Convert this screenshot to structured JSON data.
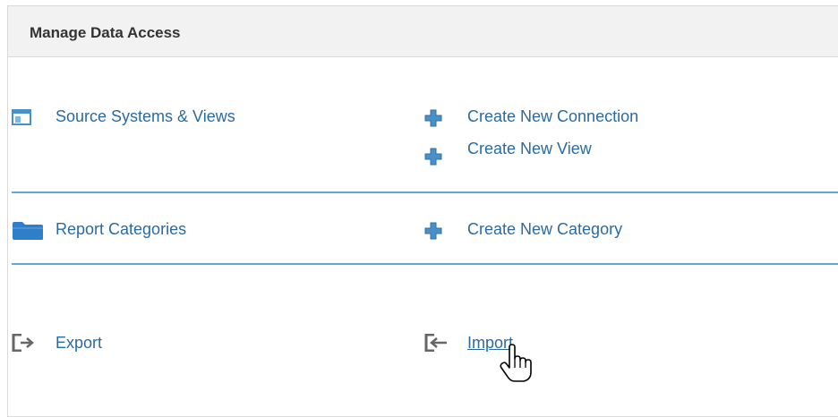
{
  "panel": {
    "title": "Manage Data Access"
  },
  "sections": {
    "source_systems": {
      "label": "Source Systems & Views",
      "icon": "window-icon",
      "actions": [
        {
          "label": "Create New Connection",
          "icon": "plus-icon"
        },
        {
          "label": "Create New View",
          "icon": "plus-icon"
        }
      ]
    },
    "report_categories": {
      "label": "Report Categories",
      "icon": "folder-icon",
      "actions": [
        {
          "label": "Create New Category",
          "icon": "plus-icon"
        }
      ]
    },
    "transfer": {
      "export_label": "Export",
      "export_icon": "export-icon",
      "import_label": "Import",
      "import_icon": "import-icon"
    }
  },
  "colors": {
    "link": "#2a6aa3",
    "divider": "#5fa7d9",
    "icon_blue": "#4a90c8",
    "icon_gray": "#666666",
    "header_bg": "#f2f2f2"
  },
  "cursor": "hand-pointer-icon"
}
